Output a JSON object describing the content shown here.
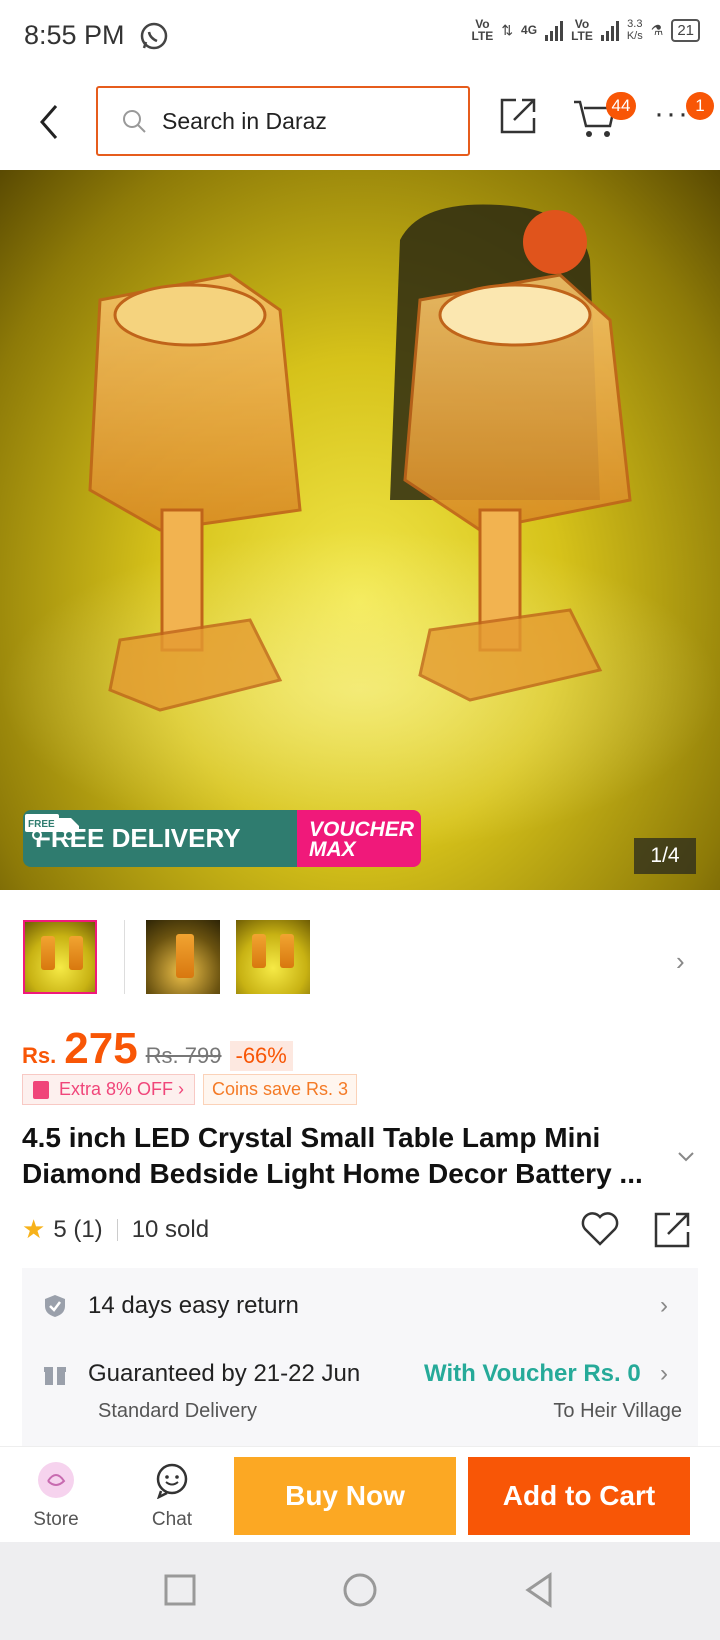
{
  "status_bar": {
    "time": "8:55 PM",
    "net1": "Vo\nLTE",
    "net2": "4G",
    "net3": "Vo\nLTE",
    "speed": "3.3\nK/s",
    "battery": "21"
  },
  "header": {
    "search_placeholder": "Search in Daraz",
    "cart_count": "44",
    "more_badge": "1"
  },
  "gallery": {
    "promo_free": "FREE DELIVERY",
    "promo_voucher_line1": "VOUCHER",
    "promo_voucher_line2": "MAX",
    "truck_label": "FREE",
    "counter": "1/4"
  },
  "price": {
    "currency": "Rs.",
    "value": "275",
    "original": "Rs. 799",
    "discount": "-66%"
  },
  "offers": {
    "extra": "Extra 8% OFF  ›",
    "coins": "Coins save Rs. 3"
  },
  "product": {
    "title": "4.5 inch LED Crystal Small Table Lamp Mini Diamond Bedside Light Home Decor Battery ..."
  },
  "rating": {
    "score": "5",
    "count": "(1)",
    "sold": "10 sold"
  },
  "service": {
    "return": "14 days easy return",
    "guarantee": "Guaranteed by 21-22 Jun",
    "voucher": "With Voucher Rs. 0",
    "delivery_type": "Standard Delivery",
    "location": "To Heir Village"
  },
  "bottom_bar": {
    "store": "Store",
    "chat": "Chat",
    "buy_now": "Buy Now",
    "add_to_cart": "Add to Cart"
  },
  "colors": {
    "accent": "#f85606",
    "buy": "#fca823",
    "voucher_green": "#26aa99",
    "promo_green": "#2f7c6f",
    "promo_pink": "#f0197a"
  }
}
